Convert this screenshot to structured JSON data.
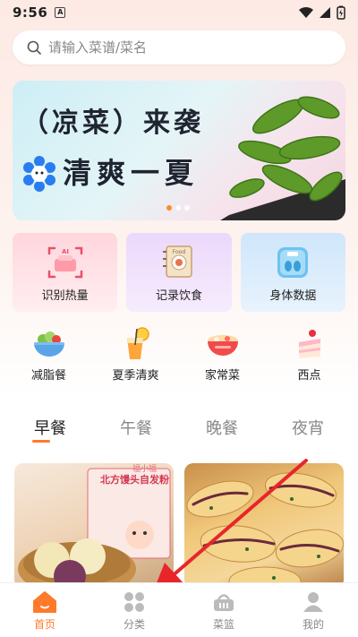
{
  "status_bar": {
    "time": "9:56",
    "notification_icon": "A"
  },
  "search": {
    "placeholder": "请输入菜谱/菜名"
  },
  "banner": {
    "line1": "（凉菜）来袭",
    "line2": "清爽一夏",
    "active_slide": 1,
    "slide_count": 3
  },
  "features": [
    {
      "label": "识别热量",
      "icon": "ai-scan-icon"
    },
    {
      "label": "记录饮食",
      "icon": "food-notebook-icon"
    },
    {
      "label": "身体数据",
      "icon": "scale-icon"
    }
  ],
  "categories": [
    {
      "label": "减脂餐",
      "icon": "salad-bowl-icon"
    },
    {
      "label": "夏季清爽",
      "icon": "juice-icon"
    },
    {
      "label": "家常菜",
      "icon": "noodle-bowl-icon"
    },
    {
      "label": "西点",
      "icon": "cake-icon"
    }
  ],
  "meal_tabs": {
    "items": [
      "早餐",
      "午餐",
      "晚餐",
      "夜宵"
    ],
    "active": "早餐"
  },
  "cards": [
    {
      "package_text": "北方馒头自发粉",
      "brand": "福小福"
    },
    {
      "package_text": ""
    }
  ],
  "tabbar": {
    "items": [
      {
        "label": "首页",
        "icon": "home-icon"
      },
      {
        "label": "分类",
        "icon": "grid-icon"
      },
      {
        "label": "菜篮",
        "icon": "basket-icon"
      },
      {
        "label": "我的",
        "icon": "user-icon"
      }
    ],
    "active": "首页"
  },
  "colors": {
    "accent": "#ff7a2a",
    "arrow": "#e8262a"
  }
}
